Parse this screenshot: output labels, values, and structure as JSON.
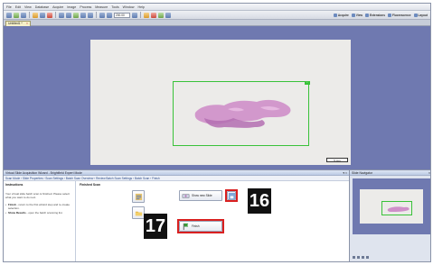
{
  "menubar": {
    "items": [
      "File",
      "Edit",
      "View",
      "Database",
      "Acquire",
      "Image",
      "Process",
      "Measure",
      "Tools",
      "Window",
      "Help"
    ]
  },
  "toolbar": {
    "zoom": "200.00",
    "right_items": [
      "Acquire",
      "View",
      "Extensions",
      "Fluorescence",
      "Layout"
    ]
  },
  "document": {
    "tab_label": "Untitled1 *"
  },
  "viewer": {
    "scale_label": "5 mm",
    "colors": {
      "background": "#6f79b0",
      "slide": "#ecebe9",
      "roi": "#39c239",
      "tissue": "#c98ac4"
    }
  },
  "wizard": {
    "title": "Virtual Slide Acquisition Wizard - Brightfield Expert Mode",
    "steps": "Scan Mode  ›  Slide Properties  ›  Scan Settings  ›  Batch Scan Overview  ›  Review Batch Scan Settings  ›  Batch Scan  ›  Finish",
    "instructions_heading": "Instructions",
    "instructions_text": "Your virtual slide batch scan is finished. Please select what you want to do next.",
    "bullets": [
      {
        "term": "Finish",
        "text": " - return to the first wizard step and re-create selection."
      },
      {
        "term": "Show Results",
        "text": " - open the batch scanning list."
      }
    ],
    "actions_heading": "Finished Scan",
    "buttons": {
      "show_new_slide": "Show new Slide",
      "finish": "Finish"
    }
  },
  "callouts": {
    "a": "16",
    "b": "17"
  },
  "navigator": {
    "title": "Slide Navigator"
  }
}
